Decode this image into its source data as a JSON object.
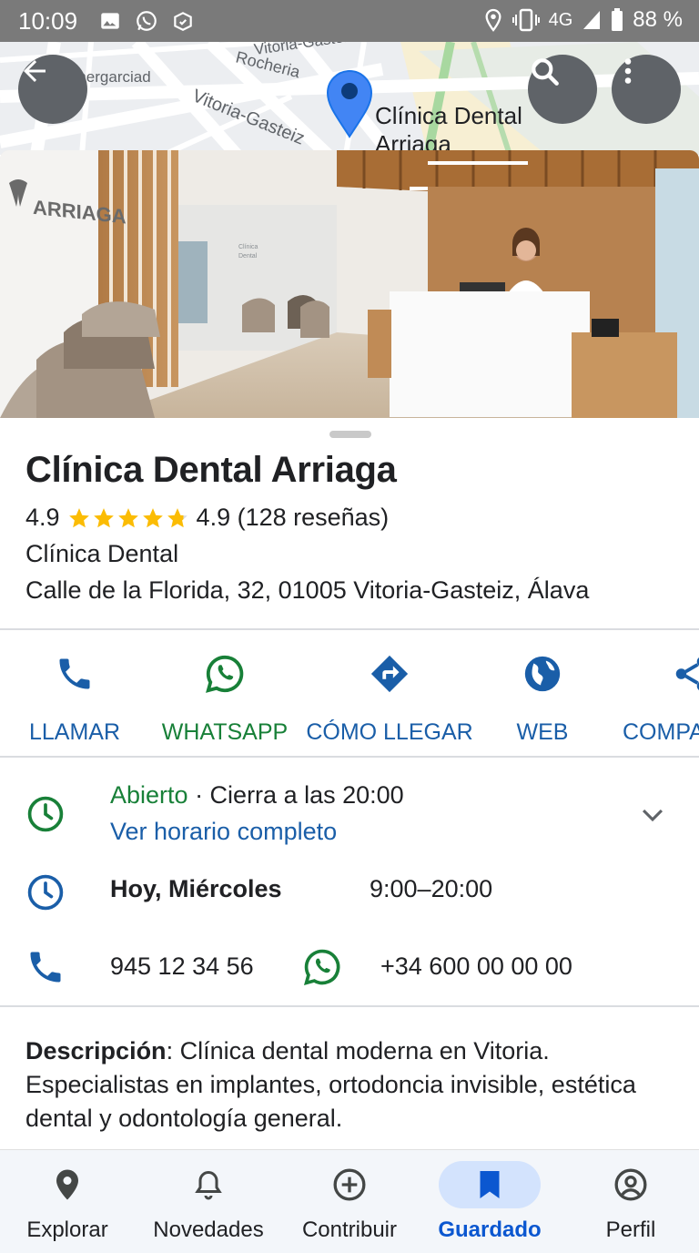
{
  "status_bar": {
    "time": "10:09",
    "network": "4G",
    "battery": "88 %"
  },
  "map": {
    "street_labels": [
      "Vitoria-Gasteiz",
      "Rocheria",
      "Energarciad",
      "Vitoria-Gasteiz"
    ],
    "pin_label_line1": "Clínica Dental",
    "pin_label_line2": "Arriaga"
  },
  "photo": {
    "sign_text": "ARRIAGA"
  },
  "place": {
    "name": "Clínica Dental Arriaga",
    "rating": "4.9",
    "stars": 4.9,
    "rating_summary": "4.9 (128 reseñas)",
    "category": "Clínica Dental",
    "address": "Calle de la Florida, 32, 01005 Vitoria-Gasteiz, Álava"
  },
  "actions": [
    {
      "label": "LLAMAR",
      "icon": "phone-icon",
      "color": "#1a5ea8"
    },
    {
      "label": "WHATSAPP",
      "icon": "whatsapp-icon",
      "color": "#188038"
    },
    {
      "label": "CÓMO LLEGAR",
      "icon": "directions-icon",
      "color": "#1a5ea8"
    },
    {
      "label": "WEB",
      "icon": "globe-icon",
      "color": "#1a5ea8"
    },
    {
      "label": "COMPA",
      "icon": "share-icon",
      "color": "#1a5ea8"
    }
  ],
  "hours": {
    "status": "Abierto",
    "closes": " · Cierra a las 20:00",
    "link": "Ver horario completo",
    "today_label": "Hoy, Miércoles",
    "today_hours": "9:00–20:00"
  },
  "contact": {
    "phone": "945 12 34 56",
    "whatsapp": "+34 600 00 00 00"
  },
  "description": {
    "label": "Descripción",
    "text": ": Clínica dental moderna en Vitoria. Especialistas en implantes, ortodoncia invisible, estética dental y odontología general."
  },
  "bottom_nav": [
    {
      "label": "Explorar",
      "icon": "location-pin-icon",
      "active": false
    },
    {
      "label": "Novedades",
      "icon": "bell-icon",
      "active": false
    },
    {
      "label": "Contribuir",
      "icon": "add-circle-icon",
      "active": false
    },
    {
      "label": "Guardado",
      "icon": "bookmark-icon",
      "active": true
    },
    {
      "label": "Perfil",
      "icon": "account-circle-icon",
      "active": false
    }
  ],
  "colors": {
    "blue": "#1a5ea8",
    "green": "#188038",
    "star": "#fbbc04",
    "nav_active_bg": "#d3e3fd"
  }
}
